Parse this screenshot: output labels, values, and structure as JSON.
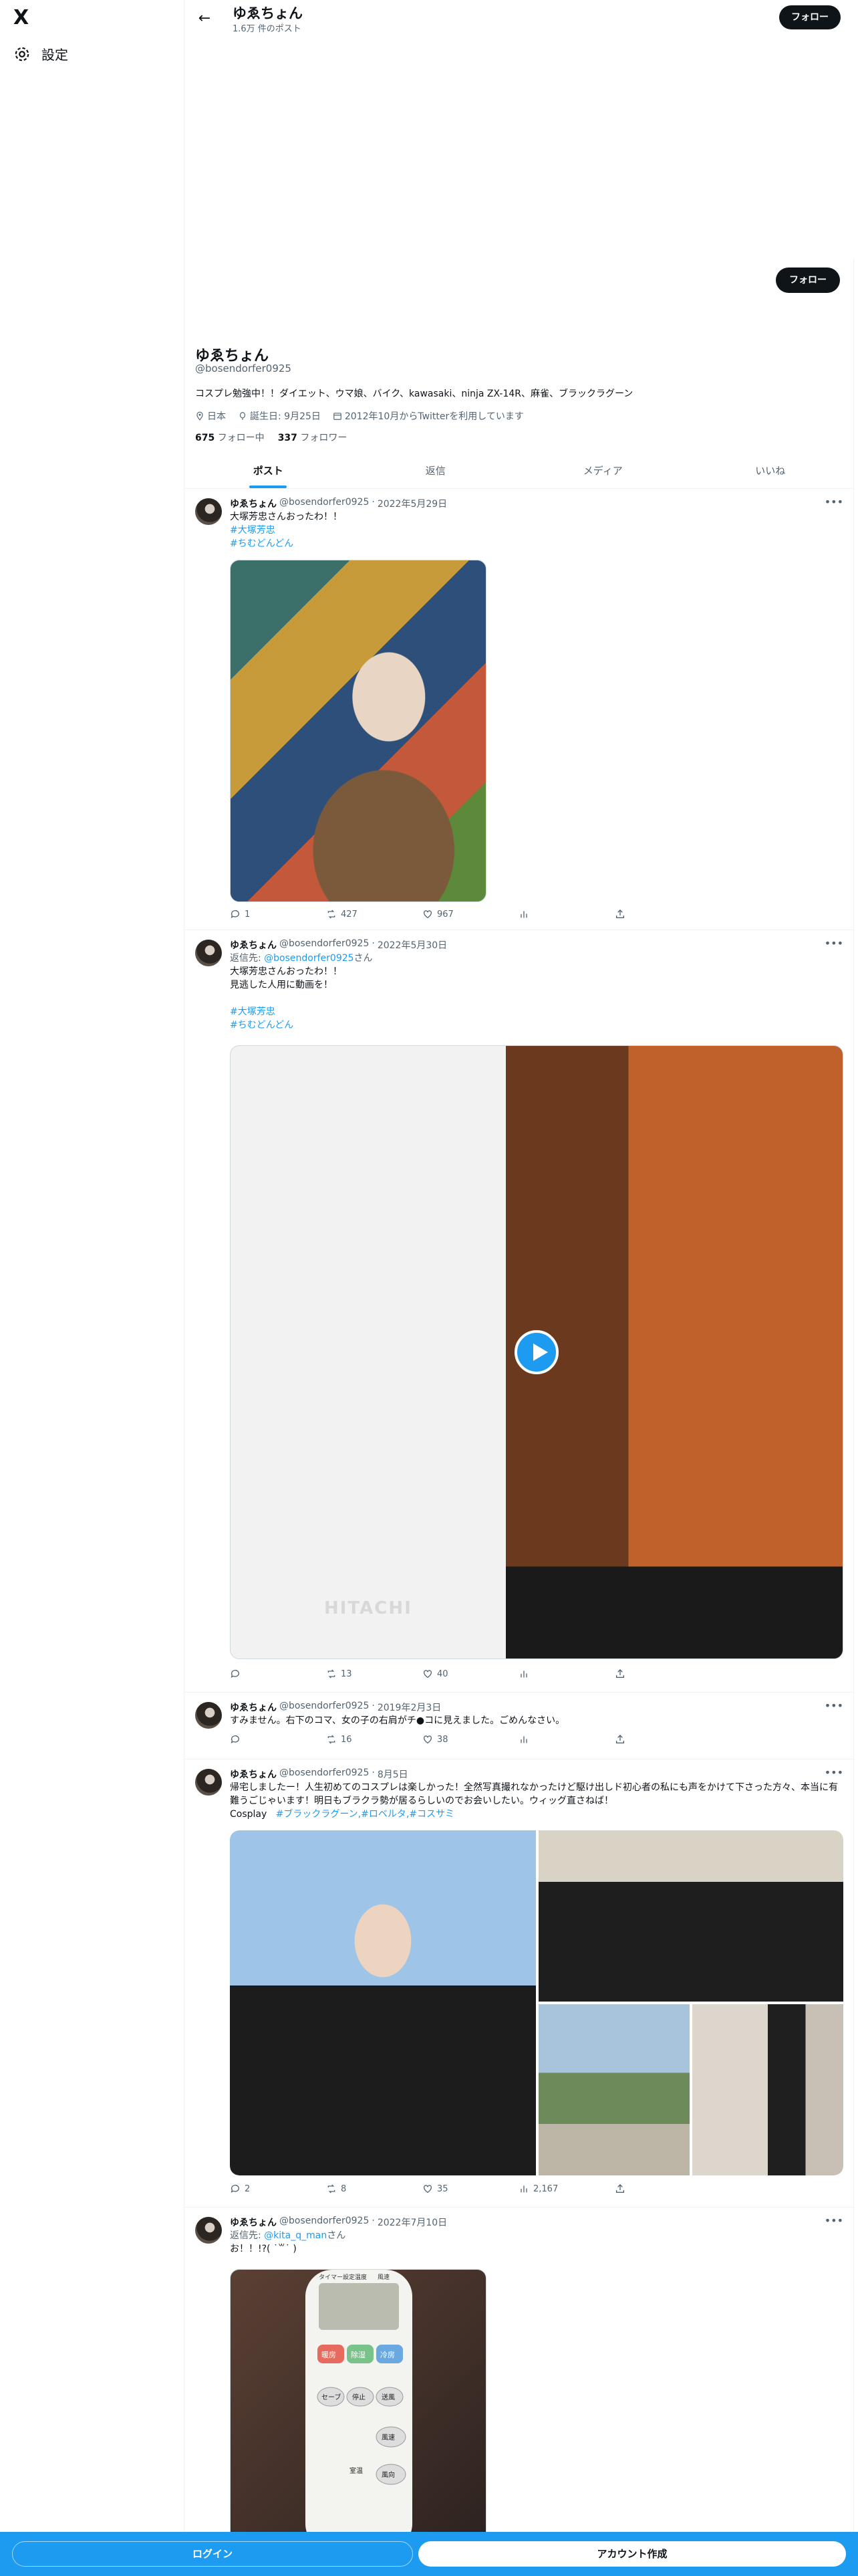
{
  "nav": {
    "logo": "X",
    "settings_label": "設定"
  },
  "header": {
    "name": "ゆゑちょん",
    "post_count": "1.6万 件のポスト",
    "follow_label": "フォロー"
  },
  "profile": {
    "follow_label": "フォロー",
    "name": "ゆゑちょん",
    "handle": "@bosendorfer0925",
    "bio": "コスプレ勉強中！！ダイエット、ウマ娘、バイク、kawasaki、ninja ZX-14R、麻雀、ブラックラグーン",
    "location": "日本",
    "birthday": "誕生日: 9月25日",
    "joined": "2012年10月からTwitterを利用しています",
    "following_count": "675",
    "following_label": "フォロー中",
    "followers_count": "337",
    "followers_label": "フォロワー"
  },
  "tabs": [
    "ポスト",
    "返信",
    "メディア",
    "いいね"
  ],
  "posts": [
    {
      "name": "ゆゑちょん",
      "handle": "@bosendorfer0925",
      "date": "2022年5月29日",
      "text": "大塚芳忠さんおったわ！！",
      "tags": [
        "#大塚芳忠",
        "#ちむどんどん"
      ],
      "replies": "1",
      "reposts": "427",
      "likes": "967",
      "views": ""
    },
    {
      "name": "ゆゑちょん",
      "handle": "@bosendorfer0925",
      "date": "2022年5月30日",
      "reply_prefix": "返信先: ",
      "reply_to": "@bosendorfer0925",
      "reply_suffix": "さん",
      "text": "大塚芳忠さんおったわ！！\n見逃した人用に動画を！",
      "tags": [
        "#大塚芳忠",
        "#ちむどんどん"
      ],
      "video_brand": "HITACHI",
      "replies": "",
      "reposts": "13",
      "likes": "40",
      "views": ""
    },
    {
      "name": "ゆゑちょん",
      "handle": "@bosendorfer0925",
      "date": "2019年2月3日",
      "text": "すみません。右下のコマ、女の子の右肩がチ●コに見えました。ごめんなさい。",
      "replies": "",
      "reposts": "16",
      "likes": "38",
      "views": ""
    },
    {
      "name": "ゆゑちょん",
      "handle": "@bosendorfer0925",
      "date": "8月5日",
      "text": "帰宅しましたー！人生初めてのコスプレは楽しかった！全然写真撮れなかったけど駆け出しド初心者の私にも声をかけて下さった方々、本当に有難うごじゃいます！明日もブラクラ勢が居るらしいのでお会いしたい。ウィッグ直さねば！",
      "cosplay_label": "Cosplay",
      "tags_inline": "#ブラックラグーン,#ロベルタ,#コスサミ",
      "replies": "2",
      "reposts": "8",
      "likes": "35",
      "views": "2,167"
    },
    {
      "name": "ゆゑちょん",
      "handle": "@bosendorfer0925",
      "date": "2022年7月10日",
      "reply_prefix": "返信先: ",
      "reply_to": "@kita_q_man",
      "reply_suffix": "さん",
      "text": "お！！!?( ˙꒳˙ )",
      "remote_labels": [
        "タイマー",
        "設定温度",
        "風速",
        "暖房",
        "除湿",
        "冷房",
        "セーブ",
        "停止",
        "送風",
        "風速",
        "室温",
        "風向"
      ]
    }
  ],
  "bottom": {
    "login_label": "ログイン",
    "signup_label": "アカウント作成"
  },
  "colors": {
    "accent": "#1d9bf0",
    "text": "#0f1419",
    "secondary": "#536471",
    "border": "#eff3f4"
  }
}
